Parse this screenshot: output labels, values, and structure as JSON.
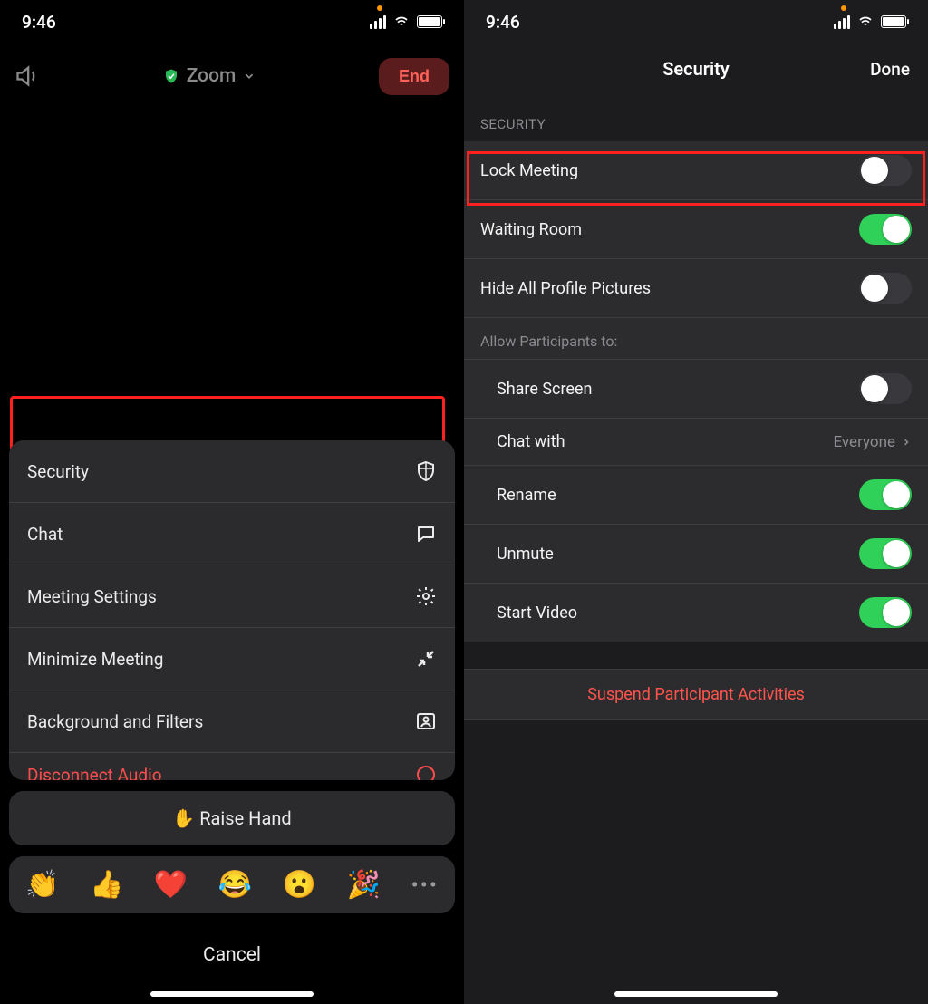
{
  "status": {
    "time": "9:46"
  },
  "left": {
    "title": "Zoom",
    "end": "End",
    "menu": {
      "security": "Security",
      "chat": "Chat",
      "settings": "Meeting Settings",
      "minimize": "Minimize Meeting",
      "background": "Background and Filters",
      "disconnect": "Disconnect Audio"
    },
    "raise_hand": "Raise Hand",
    "reactions": [
      "👏",
      "👍",
      "❤️",
      "😂",
      "😮",
      "🎉"
    ],
    "cancel": "Cancel"
  },
  "right": {
    "title": "Security",
    "done": "Done",
    "section": "SECURITY",
    "rows": {
      "lock": "Lock Meeting",
      "waiting": "Waiting Room",
      "hide_pics": "Hide All Profile Pictures",
      "allow_header": "Allow Participants to:",
      "share": "Share Screen",
      "chat_with": "Chat with",
      "chat_value": "Everyone",
      "rename": "Rename",
      "unmute": "Unmute",
      "start_video": "Start Video",
      "suspend": "Suspend Participant Activities"
    },
    "toggles": {
      "lock": false,
      "waiting": true,
      "hide_pics": false,
      "share": false,
      "rename": true,
      "unmute": true,
      "start_video": true
    }
  }
}
